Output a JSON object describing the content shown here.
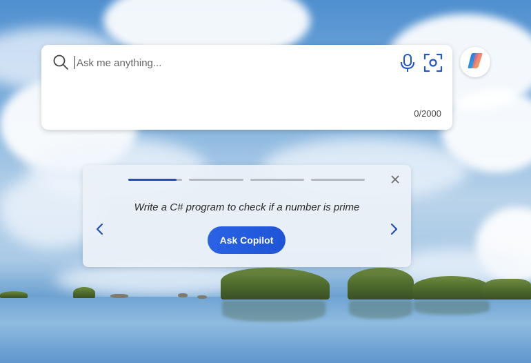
{
  "search": {
    "placeholder": "Ask me anything...",
    "char_count": "0/2000",
    "icons": [
      "search-icon",
      "microphone-icon",
      "visual-search-icon"
    ]
  },
  "copilot": {
    "icon": "copilot-logo"
  },
  "suggestion_card": {
    "progress": [
      {
        "fill": 0.9
      },
      {
        "fill": 0
      },
      {
        "fill": 0
      },
      {
        "fill": 0
      }
    ],
    "prompt": "Write a C# program to check if a number is prime",
    "button_label": "Ask Copilot",
    "icons": [
      "chevron-left-icon",
      "chevron-right-icon",
      "close-icon"
    ]
  },
  "colors": {
    "accent": "#1f54d6",
    "progress_active": "#1f4fb8",
    "progress_track": "#b5b8bd"
  }
}
